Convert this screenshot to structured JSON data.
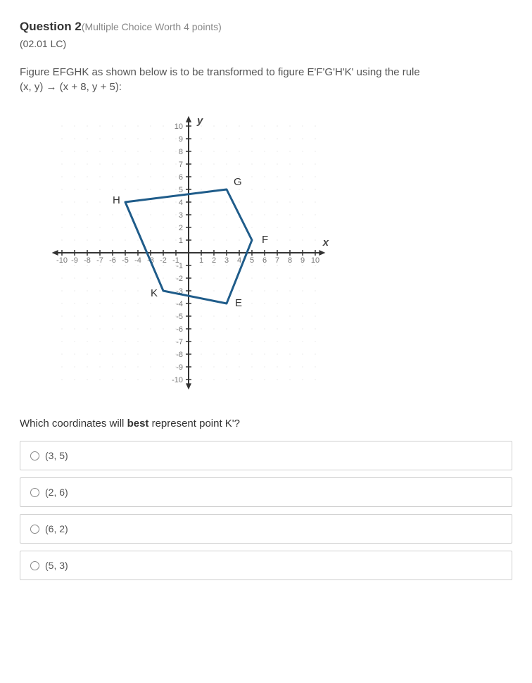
{
  "question": {
    "title_prefix": "Question 2",
    "meta": "(Multiple Choice Worth 4 points)",
    "code": "(02.01 LC)",
    "body_line1": "Figure EFGHK as shown below is to be transformed to figure E'F'G'H'K' using the rule",
    "body_line2": "(x, y) → (x + 8, y + 5):",
    "prompt_before": "Which coordinates will ",
    "prompt_bold": "best",
    "prompt_after": " represent point K'?"
  },
  "choices": [
    "(3, 5)",
    "(2, 6)",
    "(6, 2)",
    "(5, 3)"
  ],
  "chart_data": {
    "type": "scatter",
    "title": "",
    "xlabel": "x",
    "ylabel": "y",
    "xlim": [
      -10,
      10
    ],
    "ylim": [
      -10,
      10
    ],
    "x_ticks": [
      -10,
      -9,
      -8,
      -7,
      -6,
      -5,
      -4,
      -3,
      -2,
      -1,
      1,
      2,
      3,
      4,
      5,
      6,
      7,
      8,
      9,
      10
    ],
    "y_ticks": [
      -10,
      -9,
      -8,
      -7,
      -6,
      -5,
      -4,
      -3,
      -2,
      -1,
      1,
      2,
      3,
      4,
      5,
      6,
      7,
      8,
      9,
      10
    ],
    "polygon": {
      "label": "EFGHK",
      "vertices": [
        {
          "name": "E",
          "x": 3,
          "y": -4
        },
        {
          "name": "F",
          "x": 5,
          "y": 1
        },
        {
          "name": "G",
          "x": 3,
          "y": 5
        },
        {
          "name": "H",
          "x": -5,
          "y": 4
        },
        {
          "name": "K",
          "x": -2,
          "y": -3
        }
      ]
    },
    "point_labels": {
      "E": {
        "dx": 12,
        "dy": 4
      },
      "F": {
        "dx": 14,
        "dy": 4
      },
      "G": {
        "dx": 10,
        "dy": -6
      },
      "H": {
        "dx": -18,
        "dy": 2
      },
      "K": {
        "dx": -18,
        "dy": 8
      },
      "x": {
        "dx": 0,
        "dy": 0
      },
      "y": {
        "dx": 0,
        "dy": 0
      }
    }
  }
}
